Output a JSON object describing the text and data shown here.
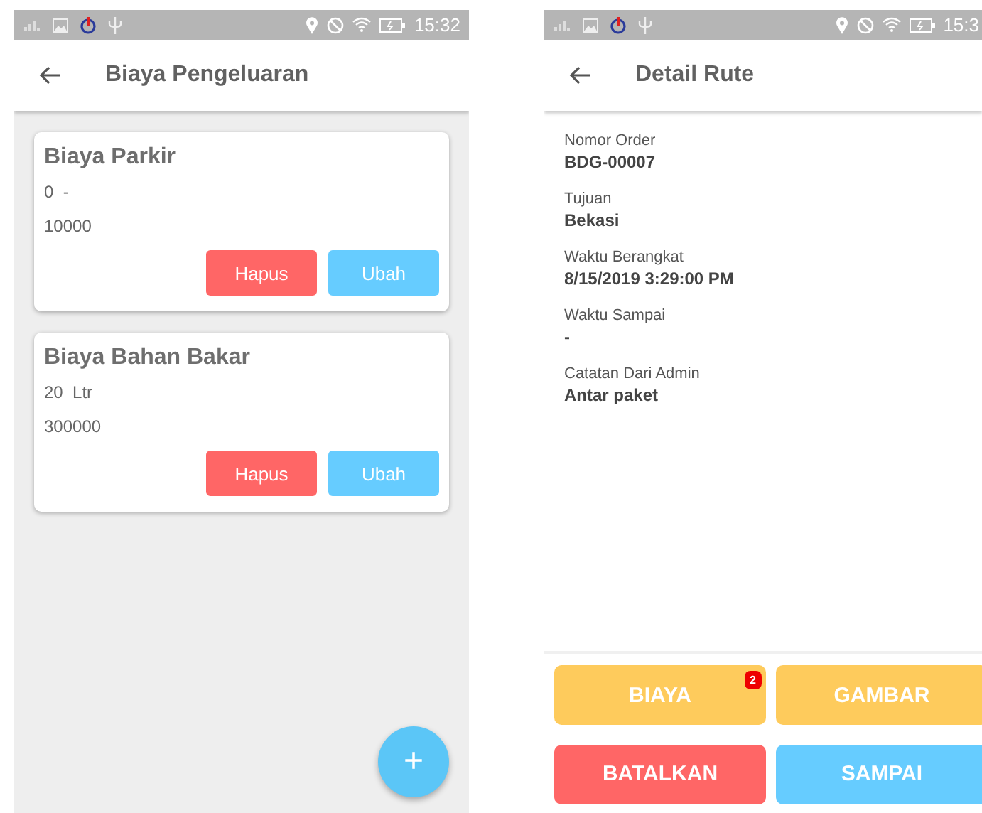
{
  "left_screen": {
    "status_bar": {
      "time": "15:32"
    },
    "title": "Biaya Pengeluaran",
    "expenses": [
      {
        "name": "Biaya Parkir",
        "quantity": "0  -",
        "amount": "10000",
        "buttons": [
          {
            "label": "Hapus",
            "kind": "delete"
          },
          {
            "label": "Ubah",
            "kind": "edit"
          }
        ]
      },
      {
        "name": "Biaya Bahan Bakar",
        "quantity": "20  Ltr",
        "amount": "300000",
        "buttons": [
          {
            "label": "Hapus",
            "kind": "delete"
          },
          {
            "label": "Ubah",
            "kind": "edit"
          }
        ]
      }
    ],
    "fab": "+"
  },
  "right_screen": {
    "status_bar": {
      "time": "15:3"
    },
    "title": "Detail Rute",
    "fields": [
      {
        "label": "Nomor Order",
        "value": "BDG-00007"
      },
      {
        "label": "Tujuan",
        "value": "Bekasi"
      },
      {
        "label": "Waktu Berangkat",
        "value": "8/15/2019 3:29:00 PM"
      },
      {
        "label": "Waktu Sampai",
        "value": "-"
      },
      {
        "label": "Catatan Dari Admin",
        "value": "Antar paket"
      }
    ],
    "actions": [
      {
        "label": "BIAYA",
        "kind": "warning",
        "badge": "2"
      },
      {
        "label": "GAMBAR",
        "kind": "warning"
      },
      {
        "label": "BATALKAN",
        "kind": "danger"
      },
      {
        "label": "SAMPAI",
        "kind": "info"
      }
    ]
  }
}
